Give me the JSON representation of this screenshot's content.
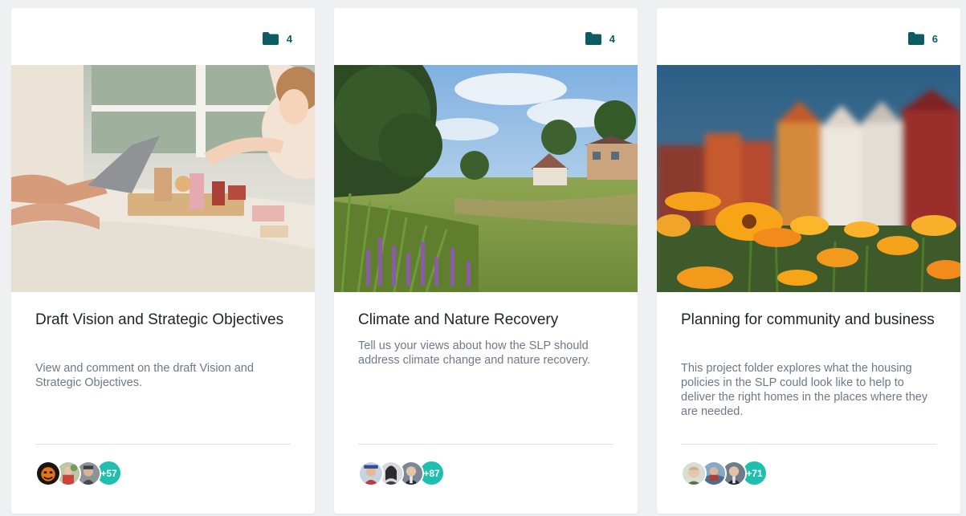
{
  "colors": {
    "accent": "#1fbfb0",
    "folder": "#0d5c63",
    "title": "#1f2328",
    "description": "#6d7a86"
  },
  "cards": [
    {
      "folder_icon": "folder-icon",
      "folder_count": "4",
      "image": "photo-baby-playing-wooden-blocks-on-bed",
      "title": "Draft Vision and Strategic Objectives",
      "description": "View and comment on the draft Vision and Strategic Objectives.",
      "avatar_count": "+57"
    },
    {
      "folder_icon": "folder-icon",
      "folder_count": "4",
      "image": "photo-green-meadow-with-houses-and-purple-flowers",
      "title": "Climate and Nature Recovery",
      "description": "Tell us your views about how the SLP should address climate change and nature recovery.",
      "avatar_count": "+87"
    },
    {
      "folder_icon": "folder-icon",
      "folder_count": "6",
      "image": "photo-orange-flowers-with-colorful-houses-background",
      "title": "Planning for community and business",
      "description": "This project folder explores what the housing policies in the SLP could look like to help to deliver the right homes in the places where they are needed.",
      "avatar_count": "+71"
    }
  ]
}
